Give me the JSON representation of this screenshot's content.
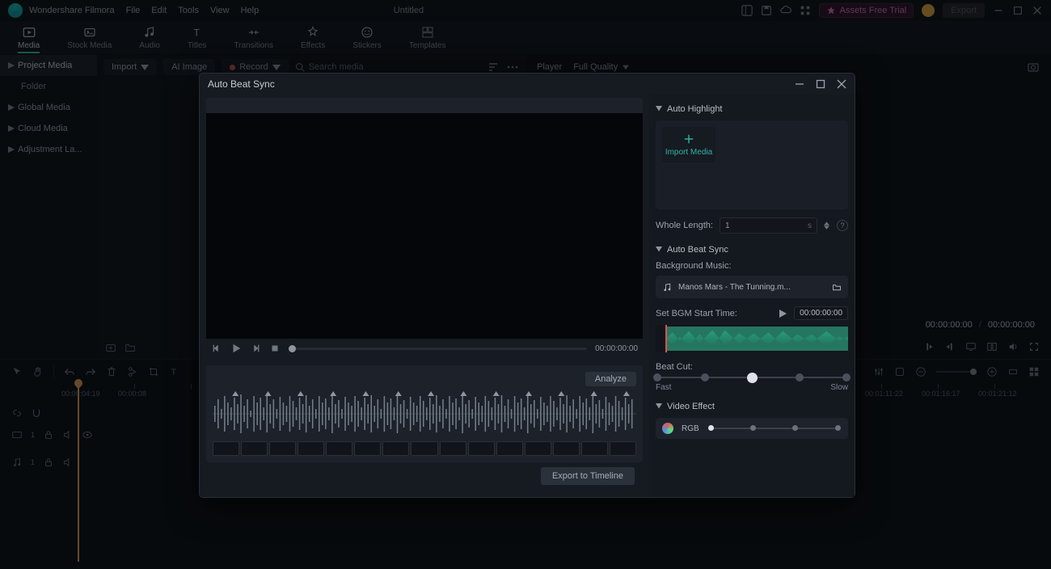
{
  "app": {
    "brand": "Wondershare Filmora",
    "title": "Untitled"
  },
  "menu": {
    "items": [
      "File",
      "Edit",
      "Tools",
      "View",
      "Help"
    ]
  },
  "menubar_right": {
    "assets": "Assets Free Trial",
    "export": "Export"
  },
  "ribbon": {
    "tabs": [
      "Media",
      "Stock Media",
      "Audio",
      "Titles",
      "Transitions",
      "Effects",
      "Stickers",
      "Templates"
    ]
  },
  "sidebar": {
    "project": "Project Media",
    "folder": "Folder",
    "global": "Global Media",
    "cloud": "Cloud Media",
    "adjustment": "Adjustment La..."
  },
  "toolbar": {
    "import": "Import",
    "ai_image": "AI Image",
    "record": "Record",
    "search_placeholder": "Search media"
  },
  "player": {
    "label": "Player",
    "quality": "Full Quality",
    "time_cur": "00:00:00:00",
    "time_sep": "/",
    "time_dur": "00:00:00:00"
  },
  "ruler": [
    "00:00:04:19",
    "00:00:08",
    "00:01:11:22",
    "00:01:16:17",
    "00:01:21:12"
  ],
  "modal": {
    "title": "Auto Beat Sync",
    "transport_time": "00:00:00:00",
    "analyze": "Analyze",
    "export_btn": "Export to Timeline",
    "auto_highlight": {
      "title": "Auto Highlight",
      "import": "Import Media",
      "whole_length_label": "Whole Length:",
      "whole_length_value": "1",
      "whole_length_unit": "s"
    },
    "beat_sync": {
      "title": "Auto Beat Sync",
      "bgm_label": "Background Music:",
      "bgm_name": "Manos Mars - The Tunning.m...",
      "start_label": "Set BGM Start Time:",
      "start_value": "00:00:00:00",
      "beat_cut_label": "Beat Cut:",
      "fast": "Fast",
      "slow": "Slow"
    },
    "video_effect": {
      "title": "Video Effect",
      "rgb": "RGB"
    }
  }
}
